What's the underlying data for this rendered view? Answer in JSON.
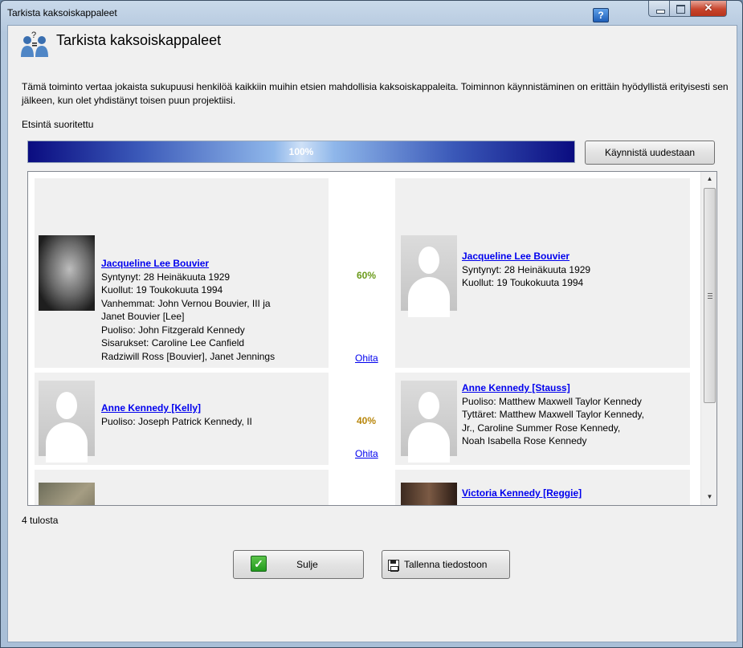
{
  "window": {
    "title": "Tarkista kaksoiskappaleet",
    "help_label": "?",
    "close_glyph": "✕"
  },
  "header": {
    "title": "Tarkista kaksoiskappaleet",
    "icon": "duplicate-people-icon"
  },
  "description": "Tämä toiminto vertaa jokaista sukupuusi henkilöä kaikkiin muihin etsien mahdollisia kaksoiskappaleita. Toiminnon käynnistäminen on erittäin hyödyllistä erityisesti sen jälkeen, kun olet yhdistänyt toisen puun projektiisi.",
  "status": "Etsintä suoritettu",
  "progress": {
    "value_percent": 100,
    "label": "100%"
  },
  "restart_button": "Käynnistä uudestaan",
  "results": [
    {
      "left": {
        "name": "Jacqueline Lee Bouvier",
        "lines": [
          "Syntynyt: 28 Heinäkuuta 1929",
          "Kuollut: 19 Toukokuuta 1994",
          "Vanhemmat: John Vernou Bouvier, III ja",
          "Janet Bouvier [Lee]",
          "Puoliso: John Fitzgerald Kennedy",
          "Sisarukset: Caroline Lee Canfield",
          "Radziwill Ross [Bouvier], Janet Jennings"
        ],
        "photo": "photo"
      },
      "match": "60%",
      "match_color": "#6a9a1a",
      "skip": "Ohita",
      "right": {
        "name": "Jacqueline Lee Bouvier",
        "lines": [
          "Syntynyt: 28 Heinäkuuta 1929",
          "Kuollut: 19 Toukokuuta 1994"
        ],
        "photo": "silhouette"
      }
    },
    {
      "left": {
        "name": "Anne Kennedy [Kelly]",
        "lines": [
          "Puoliso: Joseph Patrick Kennedy, II"
        ],
        "photo": "silhouette"
      },
      "match": "40%",
      "match_color": "#b8860b",
      "skip": "Ohita",
      "right": {
        "name": "Anne Kennedy [Stauss]",
        "lines": [
          "Puoliso: Matthew Maxwell Taylor Kennedy",
          "Tyttäret: Matthew Maxwell Taylor Kennedy,",
          "Jr., Caroline Summer Rose Kennedy,",
          "Noah Isabella Rose Kennedy"
        ],
        "photo": "silhouette"
      }
    },
    {
      "left": {
        "name": "",
        "lines": [],
        "photo": "photo"
      },
      "right": {
        "name": "Victoria Kennedy [Reggie]",
        "lines": [],
        "photo": "photo"
      }
    }
  ],
  "result_count": "4 tulosta",
  "buttons": {
    "close": "Sulje",
    "save": "Tallenna tiedostoon"
  }
}
